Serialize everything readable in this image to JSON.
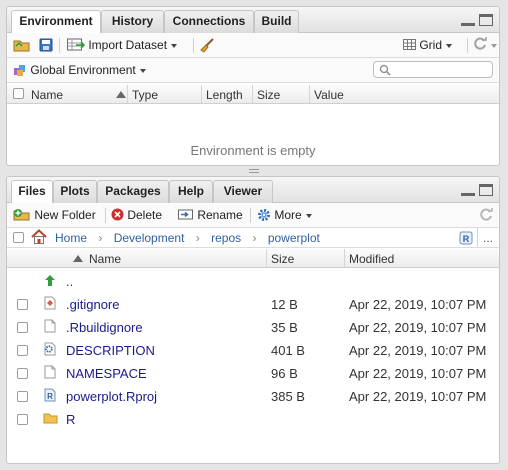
{
  "env": {
    "tabs": [
      "Environment",
      "History",
      "Connections",
      "Build"
    ],
    "toolbar": {
      "import_label": "Import Dataset",
      "view_label": "Grid"
    },
    "scope_label": "Global Environment",
    "columns": [
      "Name",
      "Type",
      "Length",
      "Size",
      "Value"
    ],
    "empty_message": "Environment is empty"
  },
  "files": {
    "tabs": [
      "Files",
      "Plots",
      "Packages",
      "Help",
      "Viewer"
    ],
    "toolbar": {
      "new_folder": "New Folder",
      "delete": "Delete",
      "rename": "Rename",
      "more": "More"
    },
    "breadcrumb": [
      "Home",
      "Development",
      "repos",
      "powerplot"
    ],
    "more_label": "...",
    "columns": {
      "name": "Name",
      "size": "Size",
      "modified": "Modified"
    },
    "rows": [
      {
        "name": "..",
        "size": "",
        "modified": "",
        "icon": "up-arrow-icon"
      },
      {
        "name": ".gitignore",
        "size": "12 B",
        "modified": "Apr 22, 2019, 10:07 PM",
        "icon": "git-file-icon"
      },
      {
        "name": ".Rbuildignore",
        "size": "35 B",
        "modified": "Apr 22, 2019, 10:07 PM",
        "icon": "text-file-icon"
      },
      {
        "name": "DESCRIPTION",
        "size": "401 B",
        "modified": "Apr 22, 2019, 10:07 PM",
        "icon": "gear-file-icon"
      },
      {
        "name": "NAMESPACE",
        "size": "96 B",
        "modified": "Apr 22, 2019, 10:07 PM",
        "icon": "text-file-icon"
      },
      {
        "name": "powerplot.Rproj",
        "size": "385 B",
        "modified": "Apr 22, 2019, 10:07 PM",
        "icon": "rproj-file-icon"
      },
      {
        "name": "R",
        "size": "",
        "modified": "",
        "icon": "folder-icon"
      }
    ]
  },
  "colors": {
    "link": "#1a1a8f",
    "accent_blue": "#2f6db5",
    "folder": "#f2c14e",
    "green": "#2e9e3e"
  }
}
